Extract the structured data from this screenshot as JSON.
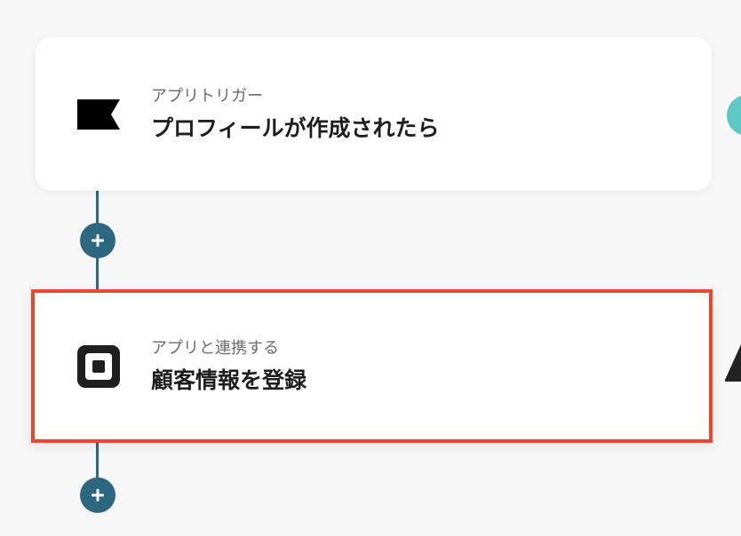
{
  "flow": {
    "trigger": {
      "label": "アプリトリガー",
      "title": "プロフィールが作成されたら",
      "icon": "flag-icon"
    },
    "action": {
      "label": "アプリと連携する",
      "title": "顧客情報を登録",
      "icon": "square-logo-icon",
      "selected_border_color": "#e54a2e"
    },
    "connector_color": "#2d6780",
    "add_step_icon": "plus-icon"
  },
  "side": {
    "bubble_icon": "teal-circle-icon",
    "bubble_color": "#5ec8c4",
    "warning_icon": "warning-triangle-icon"
  }
}
